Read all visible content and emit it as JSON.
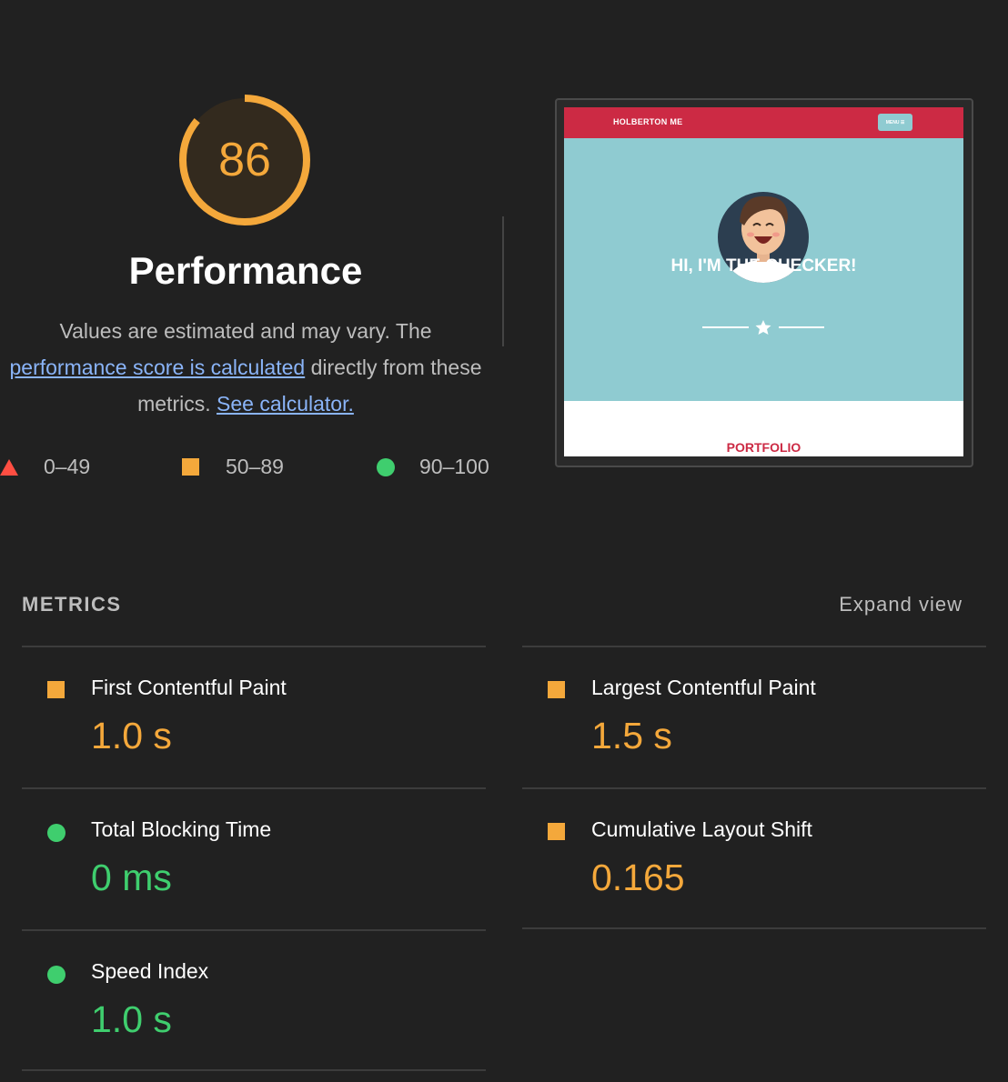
{
  "score": {
    "value": "86",
    "fraction": 0.86,
    "color": "#f4a83b"
  },
  "category": {
    "title": "Performance",
    "desc_before": "Values are estimated and may vary. The ",
    "desc_link": "performance score is calculated",
    "desc_middle": " directly from these metrics. ",
    "calc_link": "See calculator."
  },
  "legend": [
    {
      "icon": "triangle-icon",
      "range": "0–49",
      "color": "#ff4e42"
    },
    {
      "icon": "square-icon",
      "range": "50–89",
      "color": "#f4a83b"
    },
    {
      "icon": "circle-icon",
      "range": "90–100",
      "color": "#3fce6e"
    }
  ],
  "screenshot": {
    "brand": "HOLBERTON ME",
    "menu": "MENU ☰",
    "headline": "HI, I'M THE CHECKER!",
    "section": "PORTFOLIO"
  },
  "metrics_section": {
    "header": "METRICS",
    "expand": "Expand view"
  },
  "metrics": [
    {
      "title": "First Contentful Paint",
      "value": "1.0 s",
      "rating": "average"
    },
    {
      "title": "Largest Contentful Paint",
      "value": "1.5 s",
      "rating": "average"
    },
    {
      "title": "Total Blocking Time",
      "value": "0 ms",
      "rating": "pass"
    },
    {
      "title": "Cumulative Layout Shift",
      "value": "0.165",
      "rating": "average"
    },
    {
      "title": "Speed Index",
      "value": "1.0 s",
      "rating": "pass"
    }
  ]
}
